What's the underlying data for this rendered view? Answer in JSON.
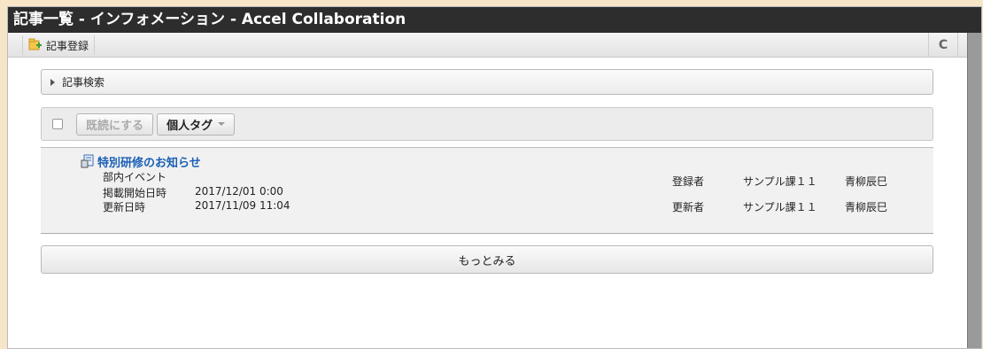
{
  "window": {
    "title": "記事一覧 - インフォメーション - Accel Collaboration"
  },
  "toolbar": {
    "register_label": "記事登録",
    "register_icon": "new-article-icon",
    "refresh_icon": "refresh-icon",
    "refresh_glyph": "C"
  },
  "search": {
    "label": "記事検索"
  },
  "actions": {
    "mark_read_label": "既読にする",
    "personal_tag_label": "個人タグ"
  },
  "articles": [
    {
      "title": "特別研修のお知らせ",
      "category": "部内イベント",
      "publish_start_label": "掲載開始日時",
      "publish_start_value": "2017/12/01 0:00",
      "updated_label": "更新日時",
      "updated_value": "2017/11/09 11:04",
      "registrant_label": "登録者",
      "registrant_dept": "サンプル課１１",
      "registrant_name": "青柳辰巳",
      "updater_label": "更新者",
      "updater_dept": "サンプル課１１",
      "updater_name": "青柳辰巳"
    }
  ],
  "more": {
    "label": "もっとみる"
  },
  "colors": {
    "title_bar": "#2d2d2d",
    "link": "#1a5fb4",
    "page_bg": "#f7e5c8"
  }
}
